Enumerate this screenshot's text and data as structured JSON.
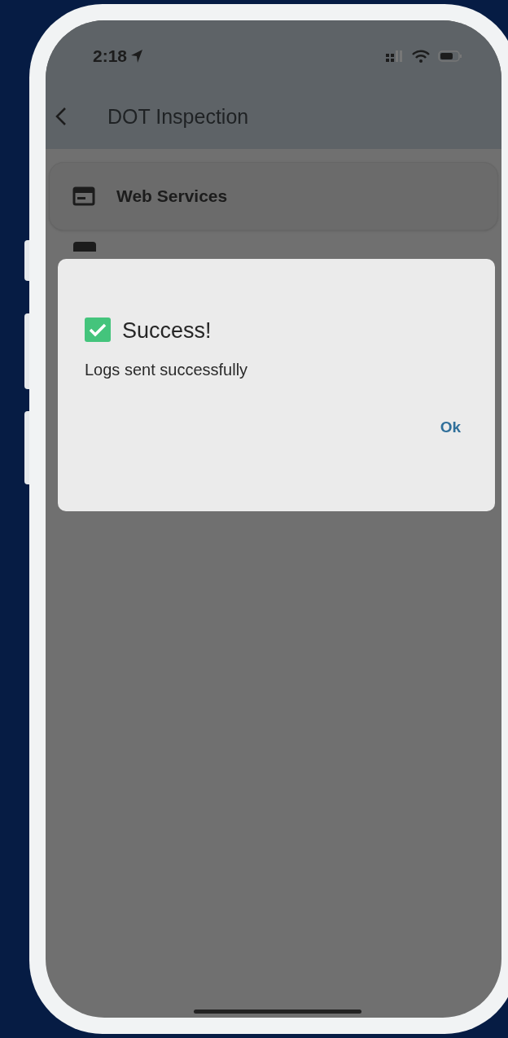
{
  "status_bar": {
    "time": "2:18"
  },
  "header": {
    "title": "DOT Inspection"
  },
  "menu_items": [
    {
      "label": "Web Services"
    }
  ],
  "dialog": {
    "title": "Success!",
    "message": "Logs sent successfully",
    "buttons": [
      "Ok"
    ]
  }
}
